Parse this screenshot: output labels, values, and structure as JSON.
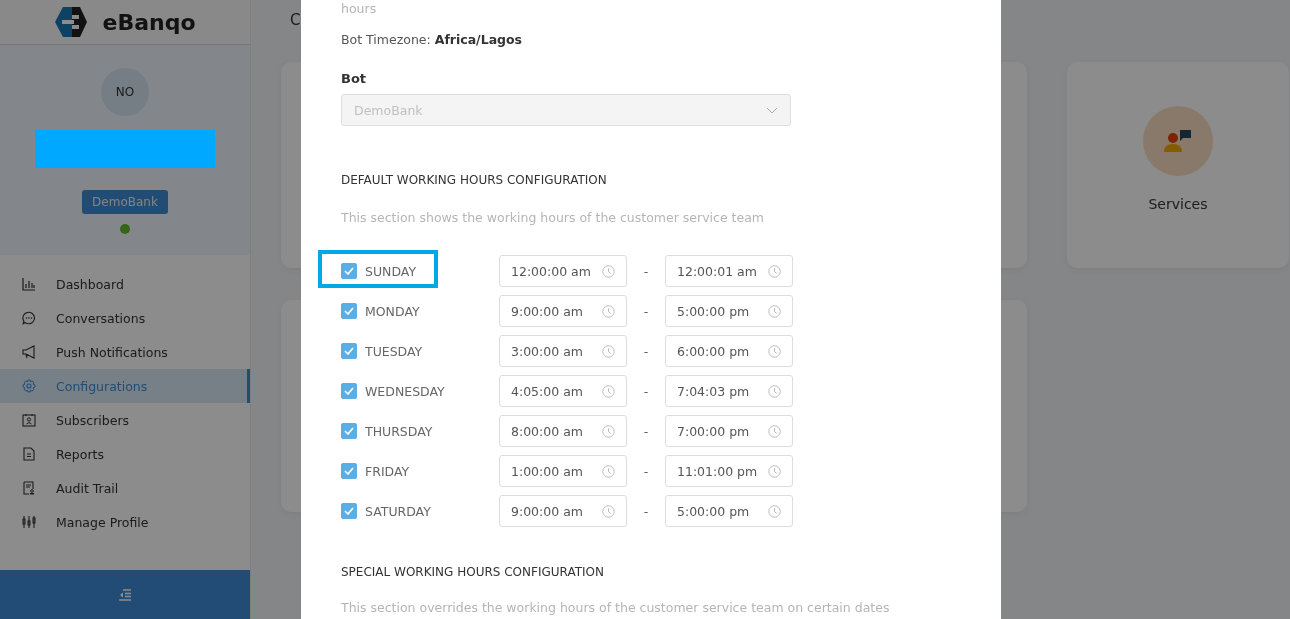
{
  "sidebar": {
    "brand": "eBanqo",
    "avatar_initials": "NO",
    "bot_badge": "DemoBank",
    "online": true,
    "items": [
      {
        "label": "Dashboard",
        "selected": false
      },
      {
        "label": "Conversations",
        "selected": false
      },
      {
        "label": "Push Notifications",
        "selected": false
      },
      {
        "label": "Configurations",
        "selected": true
      },
      {
        "label": "Subscribers",
        "selected": false
      },
      {
        "label": "Reports",
        "selected": false
      },
      {
        "label": "Audit Trail",
        "selected": false
      },
      {
        "label": "Manage Profile",
        "selected": false
      }
    ]
  },
  "page": {
    "title": "C",
    "cards": [
      {
        "label": "Services"
      }
    ]
  },
  "modal": {
    "intro_tail": "hours",
    "timezone_label": "Bot Timezone:",
    "timezone": "Africa/Lagos",
    "bot_label": "Bot",
    "bot_value": "DemoBank",
    "default_heading": "DEFAULT WORKING HOURS CONFIGURATION",
    "default_note": "This section shows the working hours of the customer service team",
    "days": [
      {
        "day": "SUNDAY",
        "checked": true,
        "highlighted": true,
        "from": "12:00:00 am",
        "to": "12:00:01 am"
      },
      {
        "day": "MONDAY",
        "checked": true,
        "highlighted": false,
        "from": "9:00:00 am",
        "to": "5:00:00 pm"
      },
      {
        "day": "TUESDAY",
        "checked": true,
        "highlighted": false,
        "from": "3:00:00 am",
        "to": "6:00:00 pm"
      },
      {
        "day": "WEDNESDAY",
        "checked": true,
        "highlighted": false,
        "from": "4:05:00 am",
        "to": "7:04:03 pm"
      },
      {
        "day": "THURSDAY",
        "checked": true,
        "highlighted": false,
        "from": "8:00:00 am",
        "to": "7:00:00 pm"
      },
      {
        "day": "FRIDAY",
        "checked": true,
        "highlighted": false,
        "from": "1:00:00 am",
        "to": "11:01:00 pm"
      },
      {
        "day": "SATURDAY",
        "checked": true,
        "highlighted": false,
        "from": "9:00:00 am",
        "to": "5:00:00 pm"
      }
    ],
    "separator": "-",
    "special_heading": "SPECIAL WORKING HOURS CONFIGURATION",
    "special_note": "This section overrides the working hours of the customer service team on certain dates"
  }
}
